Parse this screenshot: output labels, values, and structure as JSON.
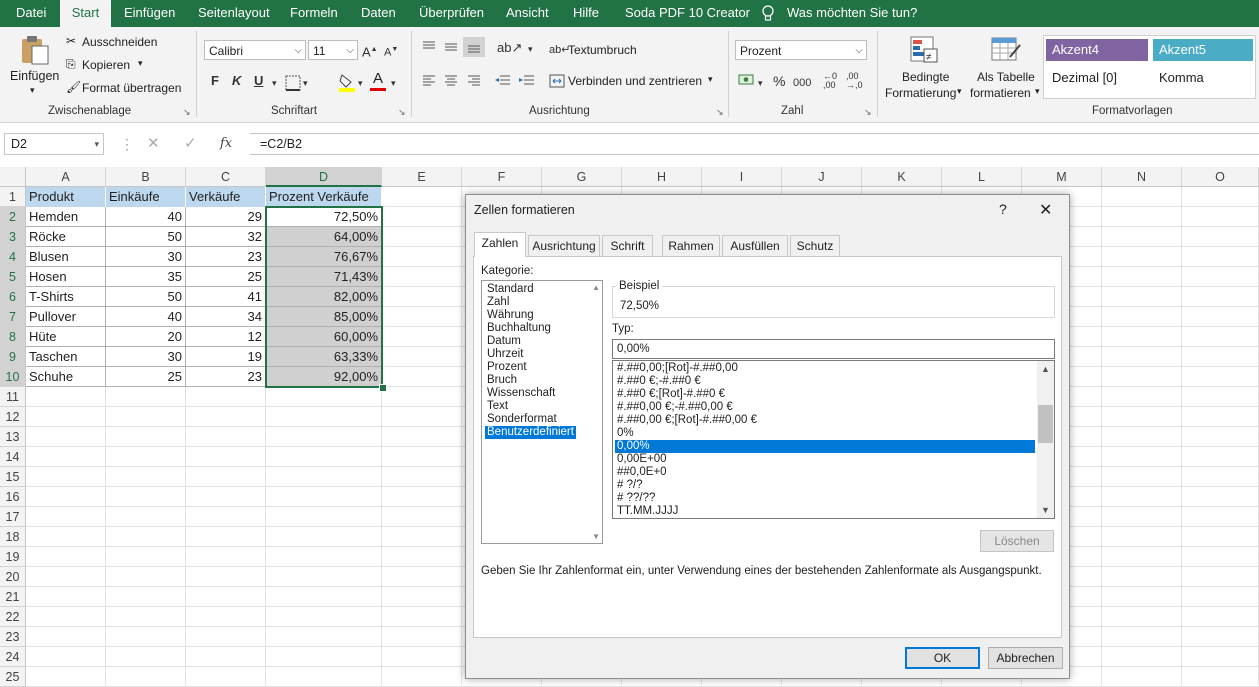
{
  "menu": {
    "items": [
      "Datei",
      "Start",
      "Einfügen",
      "Seitenlayout",
      "Formeln",
      "Daten",
      "Überprüfen",
      "Ansicht",
      "Hilfe",
      "Soda PDF 10 Creator"
    ],
    "search": "Was möchten Sie tun?"
  },
  "ribbon": {
    "clipboard": {
      "paste": "Einfügen",
      "cut": "Ausschneiden",
      "copy": "Kopieren",
      "format_painter": "Format übertragen",
      "label": "Zwischenablage"
    },
    "font": {
      "name": "Calibri",
      "size": "11",
      "bold": "F",
      "italic": "K",
      "underline": "U",
      "label": "Schriftart"
    },
    "alignment": {
      "wrap": "Textumbruch",
      "merge": "Verbinden und zentrieren",
      "label": "Ausrichtung"
    },
    "number": {
      "format": "Prozent",
      "percent": "%",
      "thousands": "000",
      "label": "Zahl"
    },
    "styles": {
      "conditional_1": "Bedingte",
      "conditional_2": "Formatierung",
      "table_1": "Als Tabelle",
      "table_2": "formatieren",
      "accent4": "Akzent4",
      "accent5": "Akzent5",
      "decimal": "Dezimal [0]",
      "comma": "Komma",
      "label": "Formatvorlagen"
    }
  },
  "formula_bar": {
    "name_box": "D2",
    "fx": "fx",
    "formula": "=C2/B2"
  },
  "grid": {
    "columns": [
      "A",
      "B",
      "C",
      "D",
      "E",
      "F",
      "G",
      "H",
      "I",
      "J",
      "K",
      "L",
      "M",
      "N",
      "O"
    ],
    "rows": [
      "1",
      "2",
      "3",
      "4",
      "5",
      "6",
      "7",
      "8",
      "9",
      "10",
      "11",
      "12",
      "13",
      "14",
      "15",
      "16",
      "17",
      "18",
      "19",
      "20",
      "21",
      "22",
      "23",
      "24",
      "25"
    ],
    "headers": [
      "Produkt",
      "Einkäufe",
      "Verkäufe",
      "Prozent Verkäufe"
    ],
    "data": [
      [
        "Hemden",
        "40",
        "29",
        "72,50%"
      ],
      [
        "Röcke",
        "50",
        "32",
        "64,00%"
      ],
      [
        "Blusen",
        "30",
        "23",
        "76,67%"
      ],
      [
        "Hosen",
        "35",
        "25",
        "71,43%"
      ],
      [
        "T-Shirts",
        "50",
        "41",
        "82,00%"
      ],
      [
        "Pullover",
        "40",
        "34",
        "85,00%"
      ],
      [
        "Hüte",
        "20",
        "12",
        "60,00%"
      ],
      [
        "Taschen",
        "30",
        "19",
        "63,33%"
      ],
      [
        "Schuhe",
        "25",
        "23",
        "92,00%"
      ]
    ]
  },
  "dialog": {
    "title": "Zellen formatieren",
    "help": "?",
    "close": "✕",
    "tabs": [
      "Zahlen",
      "Ausrichtung",
      "Schrift",
      "Rahmen",
      "Ausfüllen",
      "Schutz"
    ],
    "category_label": "Kategorie:",
    "categories": [
      "Standard",
      "Zahl",
      "Währung",
      "Buchhaltung",
      "Datum",
      "Uhrzeit",
      "Prozent",
      "Bruch",
      "Wissenschaft",
      "Text",
      "Sonderformat",
      "Benutzerdefiniert"
    ],
    "sample_label": "Beispiel",
    "sample_value": "72,50%",
    "type_label": "Typ:",
    "type_value": "0,00%",
    "types": [
      "#.##0,00;[Rot]-#.##0,00",
      "#.##0 €;-#.##0 €",
      "#.##0 €;[Rot]-#.##0 €",
      "#.##0,00 €;-#.##0,00 €",
      "#.##0,00 €;[Rot]-#.##0,00 €",
      "0%",
      "0,00%",
      "0,00E+00",
      "##0,0E+0",
      "# ?/?",
      "# ??/??",
      "TT.MM.JJJJ"
    ],
    "delete_button": "Löschen",
    "hint": "Geben Sie Ihr Zahlenformat ein, unter Verwendung eines der bestehenden Zahlenformate als Ausgangspunkt.",
    "ok": "OK",
    "cancel": "Abbrechen"
  },
  "colors": {
    "excel_green": "#217346",
    "header_fill": "#bdd7ee",
    "accent4": "#8064a2",
    "accent5": "#4bacc6",
    "selection": "#0078d7"
  }
}
